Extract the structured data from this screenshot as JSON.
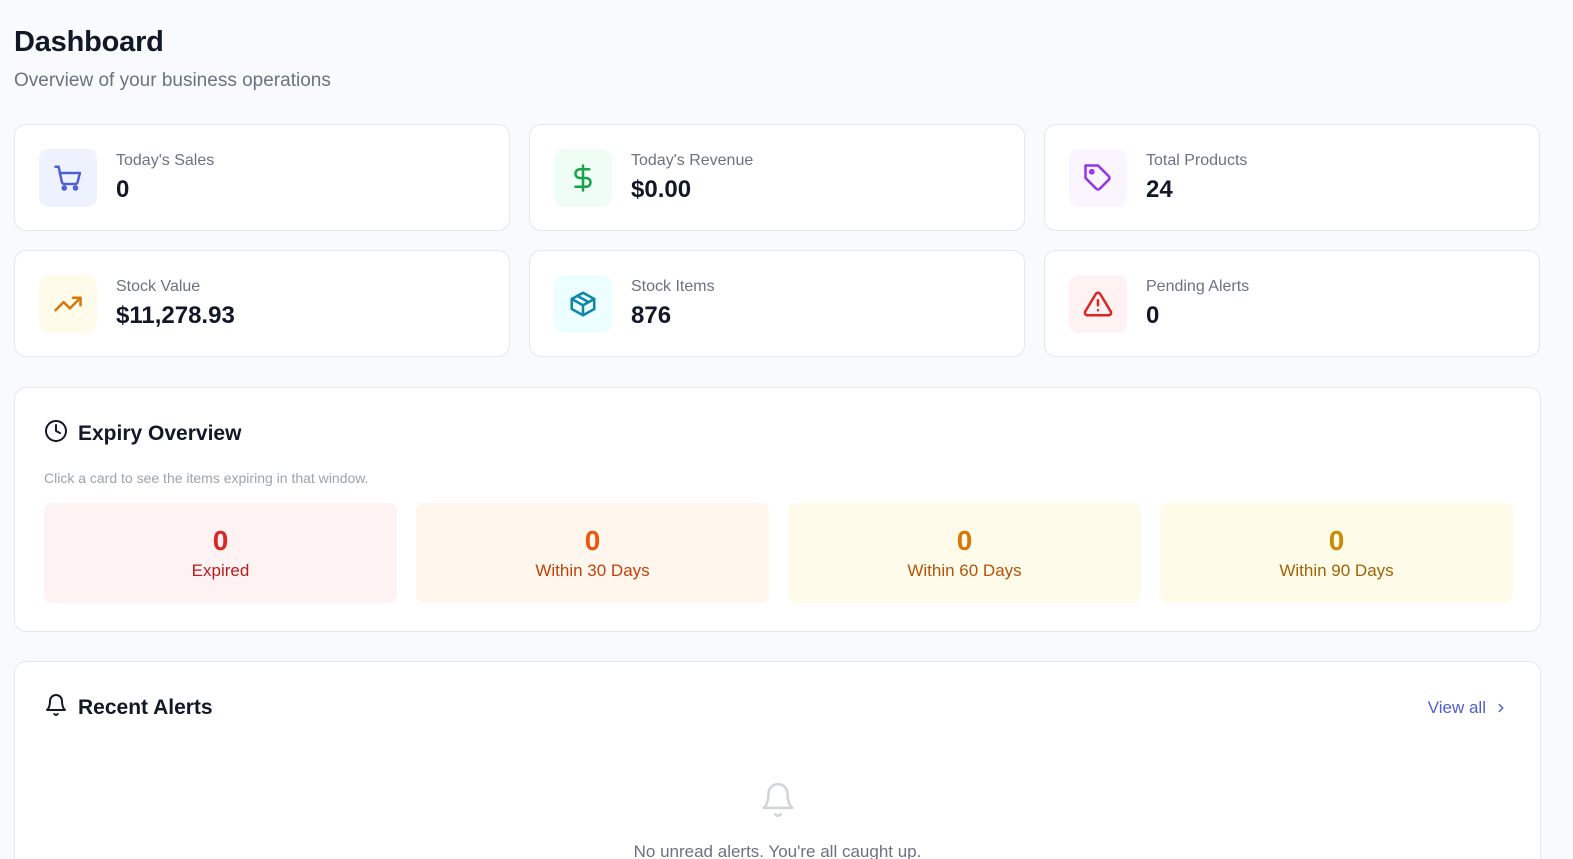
{
  "header": {
    "title": "Dashboard",
    "subtitle": "Overview of your business operations"
  },
  "stats": [
    {
      "label": "Today's Sales",
      "value": "0",
      "icon": "shopping-cart-icon",
      "color": "#4f5fd1",
      "bg": "#eef2ff"
    },
    {
      "label": "Today's Revenue",
      "value": "$0.00",
      "icon": "dollar-icon",
      "color": "#16a34a",
      "bg": "#f0fdf4"
    },
    {
      "label": "Total Products",
      "value": "24",
      "icon": "tag-icon",
      "color": "#9333ea",
      "bg": "#faf5ff"
    },
    {
      "label": "Stock Value",
      "value": "$11,278.93",
      "icon": "trending-up-icon",
      "color": "#d97706",
      "bg": "#fffbeb"
    },
    {
      "label": "Stock Items",
      "value": "876",
      "icon": "package-icon",
      "color": "#0891b2",
      "bg": "#ecfeff"
    },
    {
      "label": "Pending Alerts",
      "value": "0",
      "icon": "alert-triangle-icon",
      "color": "#dc2626",
      "bg": "#fef2f2"
    }
  ],
  "expiry": {
    "title": "Expiry Overview",
    "hint": "Click a card to see the items expiring in that window.",
    "cards": [
      {
        "count": "0",
        "label": "Expired",
        "count_color": "#dc2626",
        "label_color": "#b91c1c",
        "bg": "#fef2f2"
      },
      {
        "count": "0",
        "label": "Within 30 Days",
        "count_color": "#ea580c",
        "label_color": "#c2410c",
        "bg": "#fff7ed"
      },
      {
        "count": "0",
        "label": "Within 60 Days",
        "count_color": "#d97706",
        "label_color": "#b45309",
        "bg": "#fffbeb"
      },
      {
        "count": "0",
        "label": "Within 90 Days",
        "count_color": "#ca8a04",
        "label_color": "#a16207",
        "bg": "#fefce8"
      }
    ]
  },
  "alerts": {
    "title": "Recent Alerts",
    "view_all": "View all",
    "empty_text": "No unread alerts. You're all caught up."
  }
}
